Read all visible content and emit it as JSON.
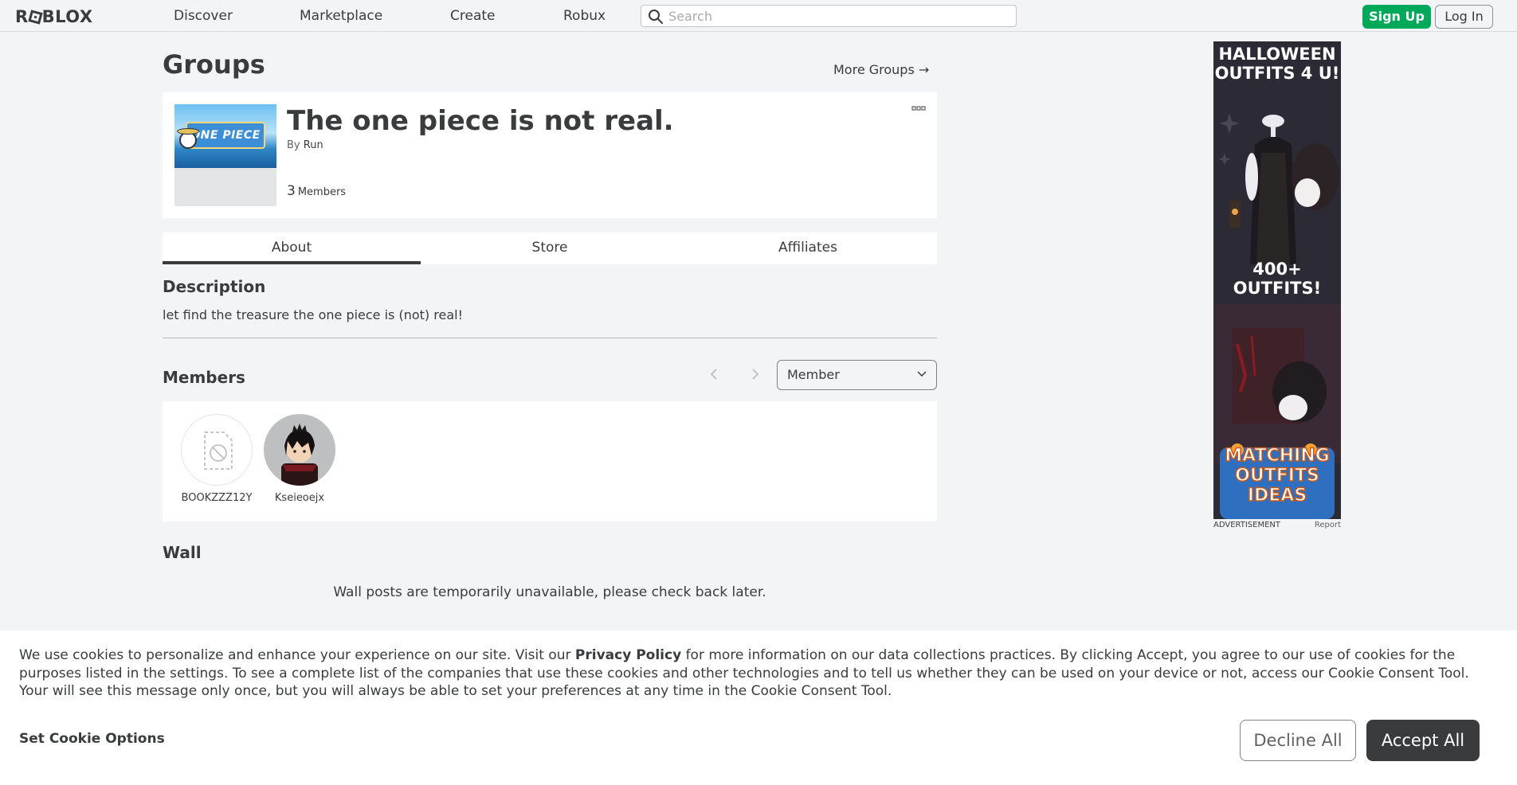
{
  "nav": {
    "logo": "ROBLOX",
    "links": [
      "Discover",
      "Marketplace",
      "Create",
      "Robux"
    ],
    "search_placeholder": "Search",
    "signup_label": "Sign Up",
    "login_label": "Log In"
  },
  "page": {
    "title": "Groups",
    "more_groups": "More Groups →"
  },
  "group": {
    "name": "The one piece is not real.",
    "by_prefix": "By",
    "owner": "Run",
    "member_count": "3",
    "member_label": "Members",
    "thumb_text": "ONE PIECE"
  },
  "tabs": [
    "About",
    "Store",
    "Affiliates"
  ],
  "about": {
    "description_heading": "Description",
    "description": "let find the treasure the one piece is (not) real!",
    "members_heading": "Members",
    "role_filter": "Member",
    "members": [
      {
        "name": "BOOKZZZ12Y",
        "avatar": "unavailable-icon"
      },
      {
        "name": "Kseieoejx",
        "avatar": "user-avatar"
      }
    ],
    "wall_heading": "Wall",
    "wall_message": "Wall posts are temporarily unavailable, please check back later."
  },
  "ad": {
    "headline": "HALLOWEEN OUTFITS 4 U!",
    "subline": "400+ OUTFITS!",
    "footer_title": "MATCHING OUTFITS IDEAS",
    "label": "ADVERTISEMENT",
    "report": "Report"
  },
  "cookie": {
    "text_1": "We use cookies to personalize and enhance your experience on our site. Visit our ",
    "policy_link": "Privacy Policy",
    "text_2": " for more information on our data collections practices. By clicking Accept, you agree to our use of cookies for the purposes listed in the settings. To see a complete list of the companies that use these cookies and other technologies and to tell us whether they can be used on your device or not, access our Cookie Consent Tool. Your will see this message only once, but you will always be able to set your preferences at any time in the Cookie Consent Tool.",
    "options_label": "Set Cookie Options",
    "decline_label": "Decline All",
    "accept_label": "Accept All"
  },
  "colors": {
    "page_bg": "#f2f4f5",
    "signup_green": "#00a85a",
    "text_dark": "#393b3d"
  }
}
